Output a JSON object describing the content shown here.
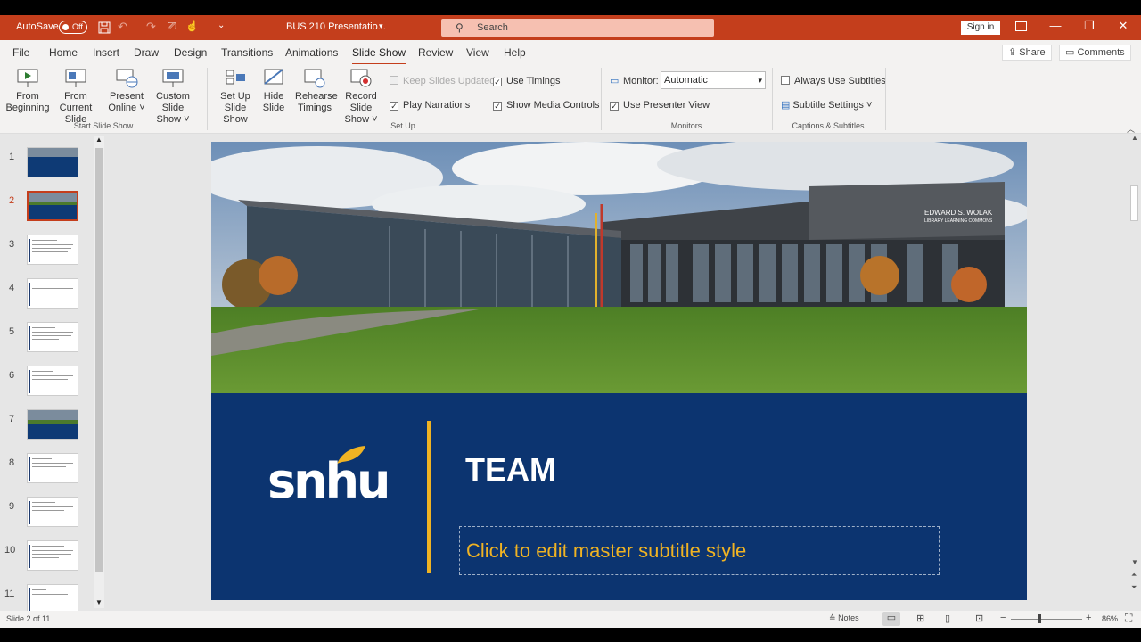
{
  "titlebar": {
    "autosave_label": "AutoSave",
    "autosave_state": "Off",
    "doc_title": "BUS 210 Presentatio...",
    "search_placeholder": "Search",
    "signin_label": "Sign in",
    "bg_color": "#c43e1c"
  },
  "menubar": {
    "tabs": [
      "File",
      "Home",
      "Insert",
      "Draw",
      "Design",
      "Transitions",
      "Animations",
      "Slide Show",
      "Review",
      "View",
      "Help"
    ],
    "active_tab": "Slide Show",
    "share_label": "Share",
    "comments_label": "Comments"
  },
  "ribbon": {
    "start_group": {
      "label": "Start Slide Show",
      "from_beginning": [
        "From",
        "Beginning"
      ],
      "from_current": [
        "From",
        "Current Slide"
      ],
      "present_online": [
        "Present",
        "Online ˅"
      ],
      "custom_show": [
        "Custom Slide",
        "Show ˅"
      ]
    },
    "setup_group": {
      "label": "Set Up",
      "setup_show": [
        "Set Up",
        "Slide Show"
      ],
      "hide_slide": [
        "Hide",
        "Slide"
      ],
      "rehearse": [
        "Rehearse",
        "Timings"
      ],
      "record": [
        "Record Slide",
        "Show ˅"
      ],
      "keep_updated": "Keep Slides Updated",
      "play_narrations": "Play Narrations",
      "use_timings": "Use Timings",
      "show_media_controls": "Show Media Controls"
    },
    "monitors_group": {
      "label": "Monitors",
      "monitor_label": "Monitor:",
      "monitor_value": "Automatic",
      "presenter_view": "Use Presenter View"
    },
    "captions_group": {
      "label": "Captions & Subtitles",
      "always_subtitles": "Always Use Subtitles",
      "subtitle_settings": "Subtitle Settings ˅"
    }
  },
  "thumbnails": {
    "numbers": [
      "1",
      "2",
      "3",
      "4",
      "5",
      "6",
      "7",
      "8",
      "9",
      "10",
      "11"
    ],
    "selected_index": 2
  },
  "slide": {
    "title": "TEAM",
    "subtitle_placeholder": "Click to edit master subtitle style",
    "logo_text": "snhu",
    "building_sign": [
      "EDWARD S. WOLAK",
      "LIBRARY LEARNING COMMONS"
    ],
    "bg_color": "#0c3470",
    "accent_color": "#f0b323"
  },
  "status": {
    "slide_info": "Slide 2 of 11",
    "notes_label": "Notes",
    "zoom": "86%"
  }
}
